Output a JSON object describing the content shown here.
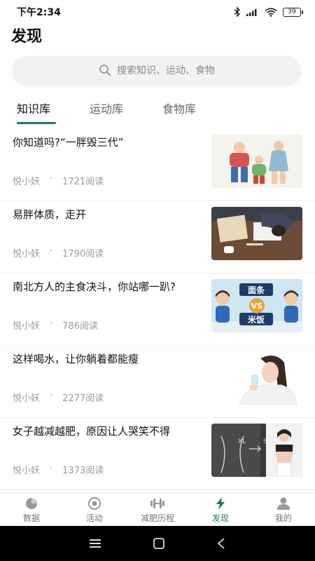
{
  "status_bar": {
    "time": "下午2:34",
    "battery": "39"
  },
  "header": {
    "title": "发现"
  },
  "search": {
    "placeholder": "搜索知识、运动、食物"
  },
  "tabs": [
    {
      "label": "知识库",
      "active": true
    },
    {
      "label": "运动库",
      "active": false
    },
    {
      "label": "食物库",
      "active": false
    }
  ],
  "articles": [
    {
      "title": "你知道吗?“一胖毁三代”",
      "author": "悦小妖",
      "reads": "1721阅读"
    },
    {
      "title": "易胖体质，走开",
      "author": "悦小妖",
      "reads": "1790阅读"
    },
    {
      "title": "南北方人的主食决斗，你站哪一趴?",
      "author": "悦小妖",
      "reads": "786阅读",
      "thumb_text_top": "面条",
      "thumb_text_mid": "VS",
      "thumb_text_bottom": "米饭"
    },
    {
      "title": "这样喝水，让你躺着都能瘦",
      "author": "悦小妖",
      "reads": "2277阅读"
    },
    {
      "title": "女子越减越肥，原因让人哭笑不得",
      "author": "悦小妖",
      "reads": "1373阅读",
      "thumb_text_xl": "XL",
      "thumb_text_s": "S"
    }
  ],
  "meta_separator": "·",
  "bottom_nav": [
    {
      "label": "数据",
      "icon": "pie-chart-icon",
      "active": false
    },
    {
      "label": "活动",
      "icon": "target-icon",
      "active": false
    },
    {
      "label": "减肥历程",
      "icon": "dumbbell-icon",
      "active": false
    },
    {
      "label": "发现",
      "icon": "lightning-icon",
      "active": true
    },
    {
      "label": "我的",
      "icon": "person-icon",
      "active": false
    }
  ],
  "colors": {
    "accent": "#1f7a5b",
    "inactive": "#777777",
    "meta": "#9a9a9a"
  }
}
